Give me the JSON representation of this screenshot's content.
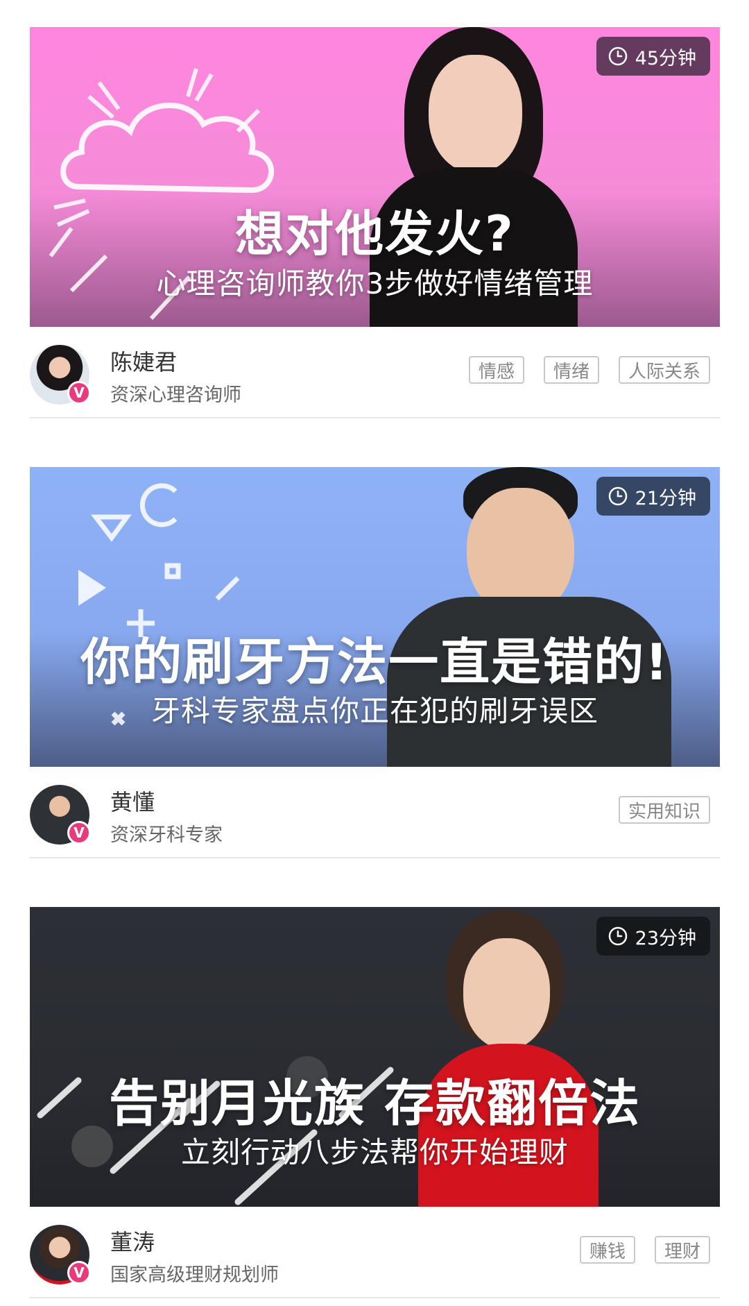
{
  "cards": [
    {
      "duration": "45分钟",
      "headline": "想对他发火?",
      "subline": "心理咨询师教你3步做好情绪管理",
      "author": {
        "name": "陈婕君",
        "title": "资深心理咨询师",
        "verified_mark": "V"
      },
      "tags": [
        "情感",
        "情绪",
        "人际关系"
      ]
    },
    {
      "duration": "21分钟",
      "headline": "你的刷牙方法一直是错的!",
      "subline": "牙科专家盘点你正在犯的刷牙误区",
      "author": {
        "name": "黄懂",
        "title": "资深牙科专家",
        "verified_mark": "V"
      },
      "tags": [
        "实用知识"
      ]
    },
    {
      "duration": "23分钟",
      "headline": "告别月光族 存款翻倍法",
      "subline": "立刻行动八步法帮你开始理财",
      "author": {
        "name": "董涛",
        "title": "国家高级理财规划师",
        "verified_mark": "V"
      },
      "tags": [
        "赚钱",
        "理财"
      ]
    }
  ],
  "colors": {
    "banner_pink": "#ff86de",
    "banner_blue": "#8fb2f7",
    "banner_dark": "#2d2f36",
    "verified": "#ea3a7e",
    "tag_border": "#c8c8c8"
  },
  "icons": {
    "duration": "clock-icon",
    "verified": "verified-badge"
  }
}
